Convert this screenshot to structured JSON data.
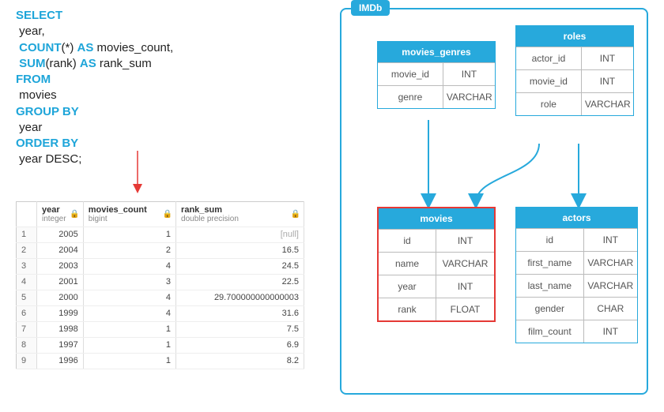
{
  "sql": {
    "lines": [
      {
        "kw": "SELECT",
        "rest": ""
      },
      {
        "kw": "",
        "rest": " year,"
      },
      {
        "kw": " COUNT",
        "mid": "(*) ",
        "kw2": "AS",
        "rest": " movies_count,"
      },
      {
        "kw": " SUM",
        "mid": "(rank",
        "mid2": ") ",
        "kw2": "AS",
        "rest": " rank_sum"
      },
      {
        "kw": "FROM",
        "rest": ""
      },
      {
        "kw": "",
        "rest": " movies"
      },
      {
        "kw": "GROUP BY",
        "rest": ""
      },
      {
        "kw": "",
        "rest": " year"
      },
      {
        "kw": "ORDER BY",
        "rest": ""
      },
      {
        "kw": "",
        "rest": " year DESC;"
      }
    ]
  },
  "result": {
    "columns": [
      {
        "name": "year",
        "type": "integer"
      },
      {
        "name": "movies_count",
        "type": "bigint"
      },
      {
        "name": "rank_sum",
        "type": "double precision"
      }
    ],
    "rows": [
      [
        "1",
        "2005",
        "1",
        "[null]"
      ],
      [
        "2",
        "2004",
        "2",
        "16.5"
      ],
      [
        "3",
        "2003",
        "4",
        "24.5"
      ],
      [
        "4",
        "2001",
        "3",
        "22.5"
      ],
      [
        "5",
        "2000",
        "4",
        "29.700000000000003"
      ],
      [
        "6",
        "1999",
        "4",
        "31.6"
      ],
      [
        "7",
        "1998",
        "1",
        "7.5"
      ],
      [
        "8",
        "1997",
        "1",
        "6.9"
      ],
      [
        "9",
        "1996",
        "1",
        "8.2"
      ]
    ]
  },
  "schema": {
    "name": "IMDb",
    "tables": {
      "movies_genres": {
        "title": "movies_genres",
        "cols": [
          [
            "movie_id",
            "INT"
          ],
          [
            "genre",
            "VARCHAR"
          ]
        ]
      },
      "roles": {
        "title": "roles",
        "cols": [
          [
            "actor_id",
            "INT"
          ],
          [
            "movie_id",
            "INT"
          ],
          [
            "role",
            "VARCHAR"
          ]
        ]
      },
      "movies": {
        "title": "movies",
        "cols": [
          [
            "id",
            "INT"
          ],
          [
            "name",
            "VARCHAR"
          ],
          [
            "year",
            "INT"
          ],
          [
            "rank",
            "FLOAT"
          ]
        ]
      },
      "actors": {
        "title": "actors",
        "cols": [
          [
            "id",
            "INT"
          ],
          [
            "first_name",
            "VARCHAR"
          ],
          [
            "last_name",
            "VARCHAR"
          ],
          [
            "gender",
            "CHAR"
          ],
          [
            "film_count",
            "INT"
          ]
        ]
      }
    }
  },
  "chart_data": {
    "type": "table",
    "title": "SQL aggregate query on movies table with IMDb schema diagram",
    "sql_query": "SELECT year, COUNT(*) AS movies_count, SUM(rank) AS rank_sum FROM movies GROUP BY year ORDER BY year DESC;",
    "result_columns": [
      "year",
      "movies_count",
      "rank_sum"
    ],
    "result_rows": [
      [
        2005,
        1,
        null
      ],
      [
        2004,
        2,
        16.5
      ],
      [
        2003,
        4,
        24.5
      ],
      [
        2001,
        3,
        22.5
      ],
      [
        2000,
        4,
        29.700000000000003
      ],
      [
        1999,
        4,
        31.6
      ],
      [
        1998,
        1,
        7.5
      ],
      [
        1997,
        1,
        6.9
      ],
      [
        1996,
        1,
        8.2
      ]
    ],
    "schema": {
      "database": "IMDb",
      "tables": [
        {
          "name": "movies_genres",
          "columns": [
            {
              "name": "movie_id",
              "type": "INT"
            },
            {
              "name": "genre",
              "type": "VARCHAR"
            }
          ]
        },
        {
          "name": "roles",
          "columns": [
            {
              "name": "actor_id",
              "type": "INT"
            },
            {
              "name": "movie_id",
              "type": "INT"
            },
            {
              "name": "role",
              "type": "VARCHAR"
            }
          ]
        },
        {
          "name": "movies",
          "highlighted": true,
          "columns": [
            {
              "name": "id",
              "type": "INT"
            },
            {
              "name": "name",
              "type": "VARCHAR"
            },
            {
              "name": "year",
              "type": "INT"
            },
            {
              "name": "rank",
              "type": "FLOAT"
            }
          ]
        },
        {
          "name": "actors",
          "columns": [
            {
              "name": "id",
              "type": "INT"
            },
            {
              "name": "first_name",
              "type": "VARCHAR"
            },
            {
              "name": "last_name",
              "type": "VARCHAR"
            },
            {
              "name": "gender",
              "type": "CHAR"
            },
            {
              "name": "film_count",
              "type": "INT"
            }
          ]
        }
      ],
      "relationships": [
        {
          "from": "movies_genres.movie_id",
          "to": "movies.id"
        },
        {
          "from": "roles.movie_id",
          "to": "movies.id"
        },
        {
          "from": "roles.actor_id",
          "to": "actors.id"
        }
      ]
    }
  }
}
